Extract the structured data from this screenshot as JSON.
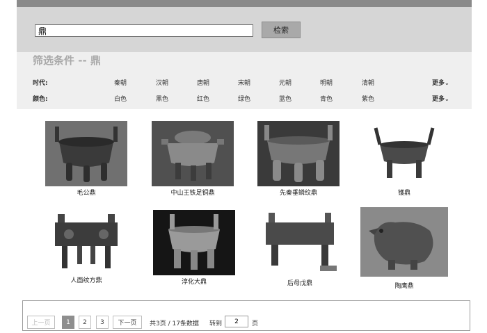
{
  "search": {
    "value": "鼎",
    "button": "检索"
  },
  "filter": {
    "title": "筛选条件 -- 鼎",
    "rows": [
      {
        "label": "时代:",
        "options": [
          "秦朝",
          "汉朝",
          "唐朝",
          "宋朝",
          "元朝",
          "明朝",
          "清朝"
        ],
        "more": "更多"
      },
      {
        "label": "颜色:",
        "options": [
          "白色",
          "黑色",
          "红色",
          "绿色",
          "蓝色",
          "青色",
          "紫色"
        ],
        "more": "更多"
      }
    ]
  },
  "results": [
    {
      "caption": "毛公鼎"
    },
    {
      "caption": "中山王铁足铜鼎"
    },
    {
      "caption": "先秦垂鳞纹鼎"
    },
    {
      "caption": "镬鼎"
    },
    {
      "caption": "人面纹方鼎"
    },
    {
      "caption": "淳化大鼎"
    },
    {
      "caption": "后母戊鼎"
    },
    {
      "caption": "陶鹰鼎"
    }
  ],
  "pager": {
    "prev": "上一页",
    "pages": [
      "1",
      "2",
      "3"
    ],
    "current": "1",
    "next": "下一页",
    "summary": "共3页 / 17条数据",
    "goto_label": "转到",
    "goto_value": "2",
    "goto_unit": "页"
  }
}
